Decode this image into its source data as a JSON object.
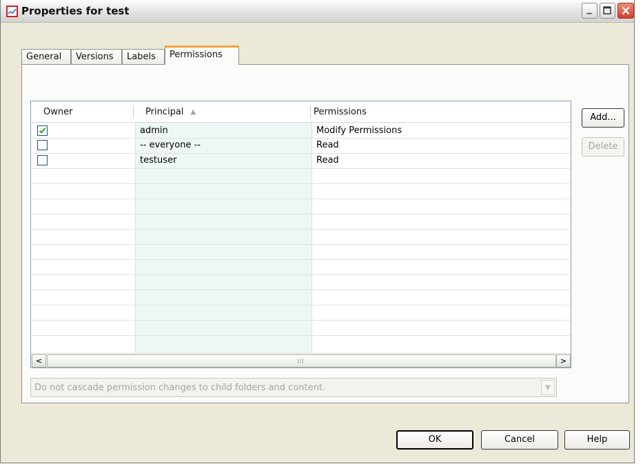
{
  "window": {
    "title": "Properties for test",
    "icon": "chart-line-icon"
  },
  "tabs": [
    {
      "label": "General",
      "active": false
    },
    {
      "label": "Versions",
      "active": false
    },
    {
      "label": "Labels",
      "active": false
    },
    {
      "label": "Permissions",
      "active": true
    }
  ],
  "grid": {
    "columns": [
      {
        "label": "Owner"
      },
      {
        "label": "Principal",
        "sorted": "ascending"
      },
      {
        "label": "Permissions"
      }
    ],
    "rows": [
      {
        "owner": true,
        "principal": "admin",
        "permissions": "Modify Permissions"
      },
      {
        "owner": false,
        "principal": "-- everyone --",
        "permissions": "Read"
      },
      {
        "owner": false,
        "principal": "testuser",
        "permissions": "Read"
      }
    ],
    "scroll_grip": "III"
  },
  "side_buttons": {
    "add_label": "Add...",
    "delete_label": "Delete"
  },
  "cascade": {
    "selected": "Do not cascade permission changes to child folders and content."
  },
  "footer": {
    "ok_label": "OK",
    "cancel_label": "Cancel",
    "help_label": "Help"
  },
  "colors": {
    "active_tab_accent": "#f3a63c",
    "checkbox_check": "#2aa02a",
    "close_button": "#d2402a",
    "principal_column_shade": "#eef7f5"
  }
}
